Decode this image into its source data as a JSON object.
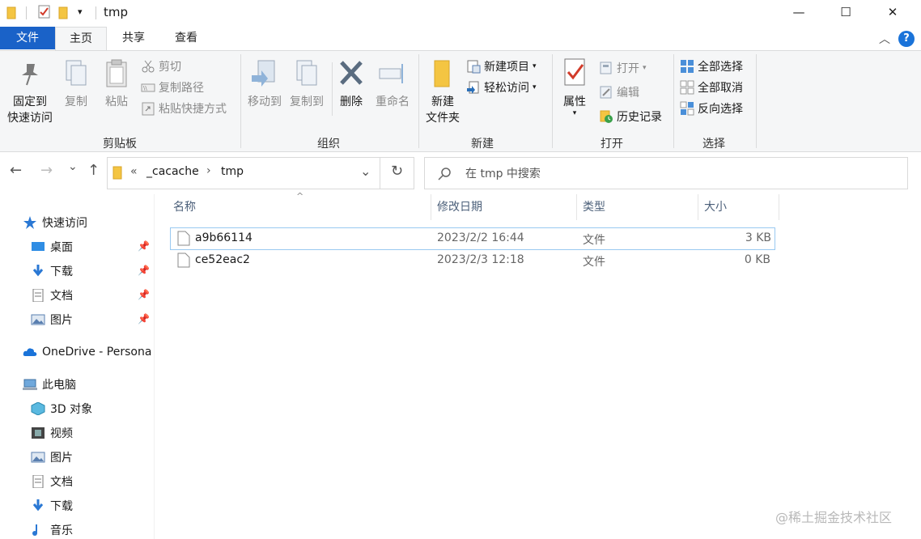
{
  "window": {
    "title": "tmp",
    "quick_access_overflow": "▾",
    "minimize": "—",
    "maximize": "☐",
    "close": "✕"
  },
  "tabs": {
    "file": "文件",
    "home": "主页",
    "share": "共享",
    "view": "查看",
    "collapse": "︿",
    "help": "?"
  },
  "ribbon": {
    "clipboard": {
      "pin": "固定到\n快速访问",
      "pin_l1": "固定到",
      "pin_l2": "快速访问",
      "copy": "复制",
      "paste": "粘贴",
      "cut": "剪切",
      "copy_path": "复制路径",
      "paste_shortcut": "粘贴快捷方式",
      "label": "剪贴板"
    },
    "organize": {
      "move_to": "移动到",
      "copy_to": "复制到",
      "delete": "删除",
      "rename": "重命名",
      "label": "组织"
    },
    "new": {
      "new_folder_l1": "新建",
      "new_folder_l2": "文件夹",
      "new_item": "新建项目",
      "easy_access": "轻松访问",
      "label": "新建"
    },
    "open": {
      "properties": "属性",
      "open": "打开",
      "edit": "编辑",
      "history": "历史记录",
      "label": "打开"
    },
    "select": {
      "select_all": "全部选择",
      "select_none": "全部取消",
      "invert": "反向选择",
      "label": "选择"
    }
  },
  "nav": {
    "back": "←",
    "forward": "→",
    "recent": "⌄",
    "up": "↑"
  },
  "address": {
    "overflow": "«",
    "crumbs": [
      "_cacache",
      "tmp"
    ],
    "sep": "›",
    "dropdown": "⌄",
    "refresh": "↻"
  },
  "search": {
    "placeholder": "在 tmp 中搜索"
  },
  "sidebar": {
    "quick_access": "快速访问",
    "items_quick": [
      "桌面",
      "下载",
      "文档",
      "图片"
    ],
    "onedrive": "OneDrive - Persona",
    "this_pc": "此电脑",
    "items_pc": [
      "3D 对象",
      "视频",
      "图片",
      "文档",
      "下载",
      "音乐"
    ]
  },
  "columns": {
    "name": "名称",
    "modified": "修改日期",
    "type": "类型",
    "size": "大小",
    "sort_indicator": "^"
  },
  "files": [
    {
      "name": "a9b66114",
      "modified": "2023/2/2 16:44",
      "type": "文件",
      "size": "3 KB"
    },
    {
      "name": "ce52eac2",
      "modified": "2023/2/3 12:18",
      "type": "文件",
      "size": "0 KB"
    }
  ],
  "watermark": "@稀土掘金技术社区",
  "colors": {
    "file_tab": "#1a62c8",
    "ribbon_bg": "#f5f6f7",
    "selection_border": "#99c9f1",
    "folder": "#f4c542",
    "accent_blue": "#1a73d9"
  }
}
